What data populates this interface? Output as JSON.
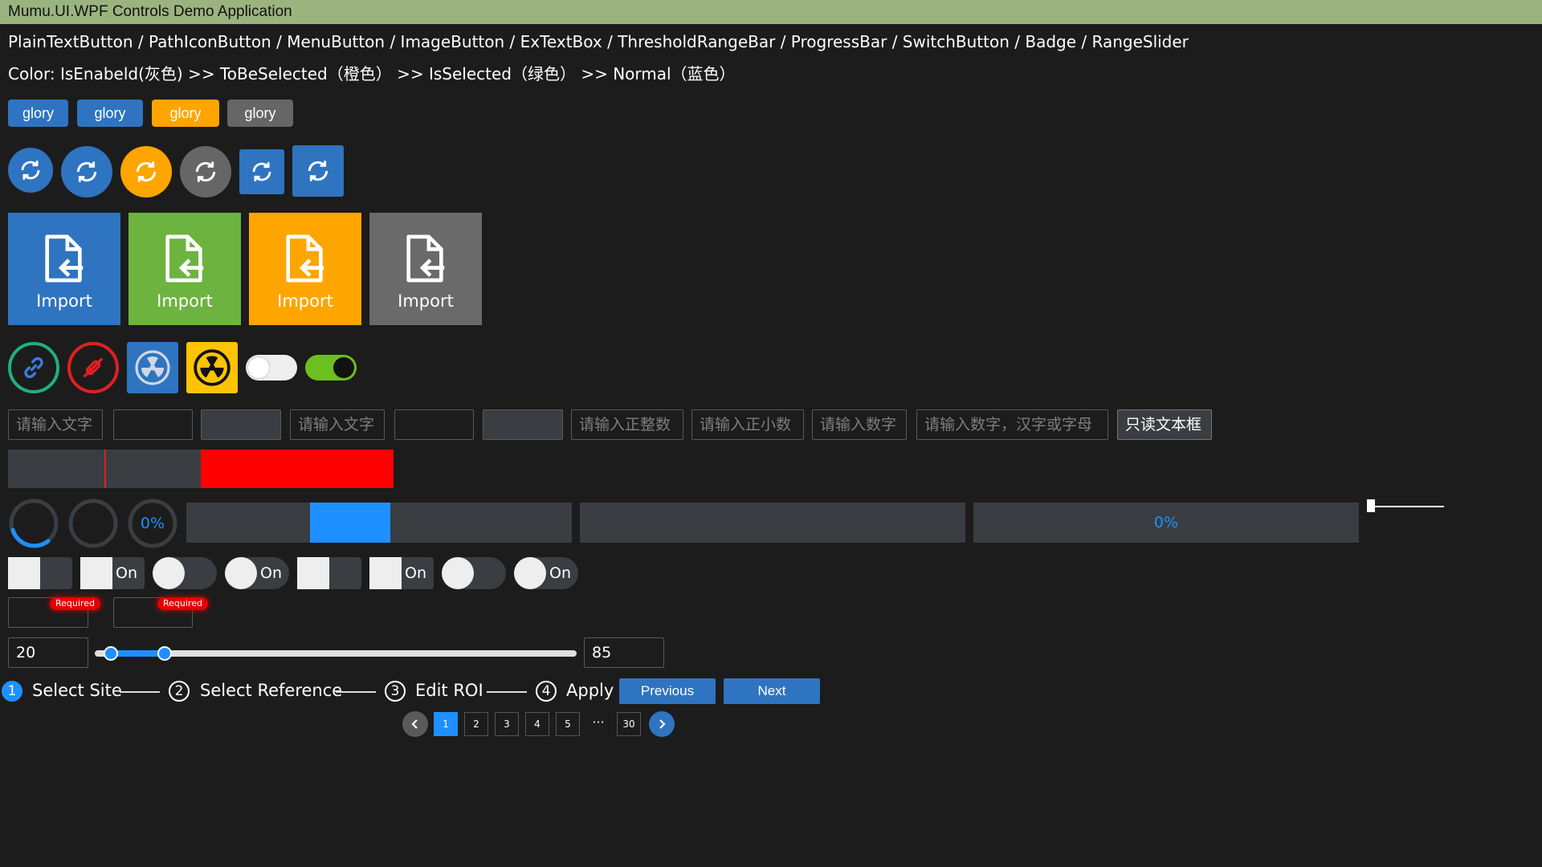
{
  "app": {
    "title": "Mumu.UI.WPF Controls Demo Application"
  },
  "header": {
    "controls_line": "PlainTextButton / PathIconButton / MenuButton / ImageButton / ExTextBox / ThresholdRangeBar / ProgressBar / SwitchButton / Badge / RangeSlider",
    "color_line": "Color: IsEnabeld(灰色) >> ToBeSelected（橙色） >> IsSelected（绿色） >> Normal（蓝色）"
  },
  "colors": {
    "blue": "#2f74c0",
    "green": "#6db33f",
    "orange": "#ffa500",
    "gray": "#666666",
    "red": "#ff0000",
    "accent": "#1e90ff"
  },
  "plain_buttons": [
    "glory",
    "glory",
    "glory",
    "glory"
  ],
  "icon_buttons": [
    {
      "icon": "refresh-icon",
      "shape": "circle",
      "color": "#2f74c0"
    },
    {
      "icon": "refresh-icon",
      "shape": "circle",
      "color": "#2f74c0"
    },
    {
      "icon": "refresh-icon",
      "shape": "circle",
      "color": "#ffa500"
    },
    {
      "icon": "refresh-icon",
      "shape": "circle",
      "color": "#666666"
    },
    {
      "icon": "refresh-icon",
      "shape": "square",
      "color": "#2f74c0"
    },
    {
      "icon": "refresh-icon",
      "shape": "square",
      "color": "#2f74c0"
    }
  ],
  "image_buttons": [
    {
      "label": "Import",
      "icon": "file-import-icon",
      "color": "#2f74c0"
    },
    {
      "label": "Import",
      "icon": "file-import-icon",
      "color": "#6db33f"
    },
    {
      "label": "Import",
      "icon": "file-import-icon",
      "color": "#ffa500"
    },
    {
      "label": "Import",
      "icon": "file-import-icon",
      "color": "#6a6a6a"
    }
  ],
  "status_icons": [
    "link-icon",
    "plug-disconnect-icon",
    "radiation-icon",
    "radiation-warning-icon"
  ],
  "toggles": [
    {
      "state": "off"
    },
    {
      "state": "on"
    }
  ],
  "textboxes": [
    {
      "placeholder": "请输入文字",
      "value": ""
    },
    {
      "placeholder": "",
      "value": ""
    },
    {
      "placeholder": "",
      "value": ""
    },
    {
      "placeholder": "请输入文字",
      "value": ""
    },
    {
      "placeholder": "",
      "value": ""
    },
    {
      "placeholder": "",
      "value": ""
    },
    {
      "placeholder": "请输入正整数",
      "value": ""
    },
    {
      "placeholder": "请输入正小数",
      "value": ""
    },
    {
      "placeholder": "请输入数字",
      "value": ""
    },
    {
      "placeholder": "请输入数字，汉字或字母",
      "value": ""
    },
    {
      "placeholder": "",
      "value": "只读文本框"
    }
  ],
  "threshold_bar": {
    "marker_fraction": 0.25,
    "threshold_start_fraction": 0.5
  },
  "progress": {
    "ring_percent_label": "0%",
    "bar_percent_label": "0%",
    "indeterminate_segment": {
      "start_fraction": 0.32,
      "end_fraction": 0.53
    }
  },
  "switch_label": "On",
  "badges": [
    "Required",
    "Required"
  ],
  "range_slider": {
    "min_label": "20",
    "max_label": "85",
    "min_fraction": 0.033,
    "max_fraction": 0.145
  },
  "steps": [
    {
      "number": "1",
      "label": "Select Site",
      "active": true
    },
    {
      "number": "2",
      "label": "Select Reference",
      "active": false
    },
    {
      "number": "3",
      "label": "Edit ROI",
      "active": false
    },
    {
      "number": "4",
      "label": "Apply",
      "active": false
    }
  ],
  "step_buttons": {
    "previous": "Previous",
    "next": "Next"
  },
  "pagination": {
    "pages": [
      "1",
      "2",
      "3",
      "4",
      "5"
    ],
    "ellipsis": "···",
    "last": "30",
    "current": "1"
  }
}
